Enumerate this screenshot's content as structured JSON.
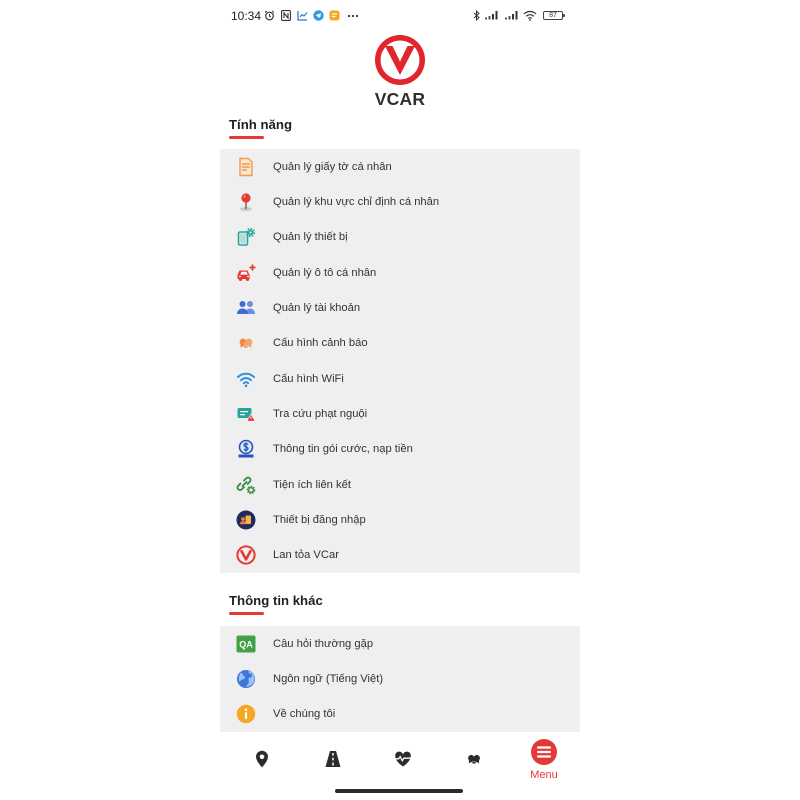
{
  "status_bar": {
    "time": "10:34",
    "battery": "87",
    "left_icons": [
      "alarm-icon",
      "nfc-icon",
      "chart-app-icon",
      "telegram-icon",
      "app-notification-icon",
      "more-notifications-icon"
    ],
    "right_icons": [
      "bluetooth-icon",
      "signal-icon",
      "signal-icon",
      "wifi-status-icon",
      "battery-icon"
    ]
  },
  "header": {
    "brand": "VCAR",
    "logo_icon": "vcar-logo-icon"
  },
  "features": {
    "title": "Tính năng",
    "items": [
      {
        "label": "Quản lý giấy tờ cá nhân",
        "icon": "document-icon"
      },
      {
        "label": "Quản lý khu vực chỉ định cá nhân",
        "icon": "map-pin-icon"
      },
      {
        "label": "Quản lý thiết bị",
        "icon": "device-settings-icon"
      },
      {
        "label": "Quản lý ô tô cá nhân",
        "icon": "car-add-icon"
      },
      {
        "label": "Quản lý tài khoản",
        "icon": "users-icon"
      },
      {
        "label": "Cấu hình cảnh báo",
        "icon": "alarm-bell-icon"
      },
      {
        "label": "Cấu hình WiFi",
        "icon": "wifi-icon"
      },
      {
        "label": "Tra cứu phạt nguội",
        "icon": "fine-warning-icon"
      },
      {
        "label": "Thông tin gói cước, nạp tiền",
        "icon": "dollar-icon"
      },
      {
        "label": "Tiện ích liên kết",
        "icon": "link-settings-icon"
      },
      {
        "label": "Thiết bị đăng nhập",
        "icon": "login-device-icon"
      },
      {
        "label": "Lan tỏa VCar",
        "icon": "vcar-logo-icon"
      }
    ]
  },
  "other_info": {
    "title": "Thông tin khác",
    "items": [
      {
        "label": "Câu hỏi thường gặp",
        "icon": "qa-icon",
        "icon_text": "QA"
      },
      {
        "label": "Ngôn ngữ (Tiếng Việt)",
        "icon": "globe-icon"
      },
      {
        "label": "Về chúng tôi",
        "icon": "info-icon"
      }
    ]
  },
  "bottom_nav": {
    "items": [
      {
        "icon": "location-icon"
      },
      {
        "icon": "road-icon"
      },
      {
        "icon": "heart-pulse-icon"
      },
      {
        "icon": "alarm-bell-icon"
      },
      {
        "icon": "menu-icon",
        "label": "Menu",
        "active": true
      }
    ]
  },
  "colors": {
    "accent": "#e53935",
    "list_background": "#efefef",
    "text": "#333333",
    "background": "#ffffff"
  }
}
